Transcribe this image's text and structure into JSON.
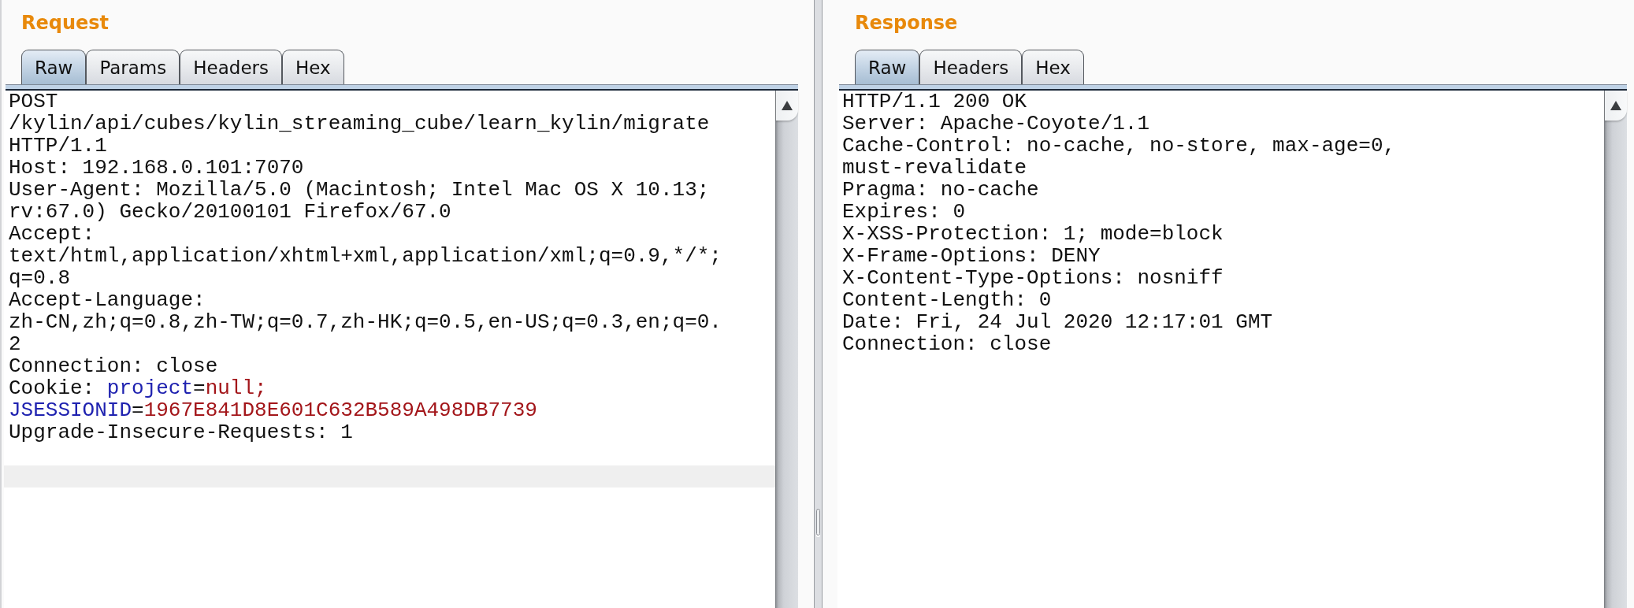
{
  "request": {
    "title": "Request",
    "tabs": [
      {
        "label": "Raw",
        "selected": true
      },
      {
        "label": "Params",
        "selected": false
      },
      {
        "label": "Headers",
        "selected": false
      },
      {
        "label": "Hex",
        "selected": false
      }
    ],
    "lines": [
      [
        {
          "kind": "plain",
          "text": "POST"
        }
      ],
      [
        {
          "kind": "plain",
          "text": "/kylin/api/cubes/kylin_streaming_cube/learn_kylin/migrate"
        }
      ],
      [
        {
          "kind": "plain",
          "text": "HTTP/1.1"
        }
      ],
      [
        {
          "kind": "plain",
          "text": "Host: 192.168.0.101:7070"
        }
      ],
      [
        {
          "kind": "plain",
          "text": "User-Agent: Mozilla/5.0 (Macintosh; Intel Mac OS X 10.13;"
        }
      ],
      [
        {
          "kind": "plain",
          "text": "rv:67.0) Gecko/20100101 Firefox/67.0"
        }
      ],
      [
        {
          "kind": "plain",
          "text": "Accept:"
        }
      ],
      [
        {
          "kind": "plain",
          "text": "text/html,application/xhtml+xml,application/xml;q=0.9,*/*;"
        }
      ],
      [
        {
          "kind": "plain",
          "text": "q=0.8"
        }
      ],
      [
        {
          "kind": "plain",
          "text": "Accept-Language:"
        }
      ],
      [
        {
          "kind": "plain",
          "text": "zh-CN,zh;q=0.8,zh-TW;q=0.7,zh-HK;q=0.5,en-US;q=0.3,en;q=0."
        }
      ],
      [
        {
          "kind": "plain",
          "text": "2"
        }
      ],
      [
        {
          "kind": "plain",
          "text": "Connection: close"
        }
      ],
      [
        {
          "kind": "plain",
          "text": "Cookie: "
        },
        {
          "kind": "param_name",
          "text": "project"
        },
        {
          "kind": "plain",
          "text": "="
        },
        {
          "kind": "param_value",
          "text": "null;"
        }
      ],
      [
        {
          "kind": "param_name",
          "text": "JSESSIONID"
        },
        {
          "kind": "plain",
          "text": "="
        },
        {
          "kind": "param_value",
          "text": "1967E841D8E601C632B589A498DB7739"
        }
      ],
      [
        {
          "kind": "plain",
          "text": "Upgrade-Insecure-Requests: 1"
        }
      ]
    ],
    "current_line_highlighted": true
  },
  "response": {
    "title": "Response",
    "tabs": [
      {
        "label": "Raw",
        "selected": true
      },
      {
        "label": "Headers",
        "selected": false
      },
      {
        "label": "Hex",
        "selected": false
      }
    ],
    "lines": [
      [
        {
          "kind": "plain",
          "text": "HTTP/1.1 200 OK"
        }
      ],
      [
        {
          "kind": "plain",
          "text": "Server: Apache-Coyote/1.1"
        }
      ],
      [
        {
          "kind": "plain",
          "text": "Cache-Control: no-cache, no-store, max-age=0,"
        }
      ],
      [
        {
          "kind": "plain",
          "text": "must-revalidate"
        }
      ],
      [
        {
          "kind": "plain",
          "text": "Pragma: no-cache"
        }
      ],
      [
        {
          "kind": "plain",
          "text": "Expires: 0"
        }
      ],
      [
        {
          "kind": "plain",
          "text": "X-XSS-Protection: 1; mode=block"
        }
      ],
      [
        {
          "kind": "plain",
          "text": "X-Frame-Options: DENY"
        }
      ],
      [
        {
          "kind": "plain",
          "text": "X-Content-Type-Options: nosniff"
        }
      ],
      [
        {
          "kind": "plain",
          "text": "Content-Length: 0"
        }
      ],
      [
        {
          "kind": "plain",
          "text": "Date: Fri, 24 Jul 2020 12:17:01 GMT"
        }
      ],
      [
        {
          "kind": "plain",
          "text": "Connection: close"
        }
      ]
    ]
  }
}
